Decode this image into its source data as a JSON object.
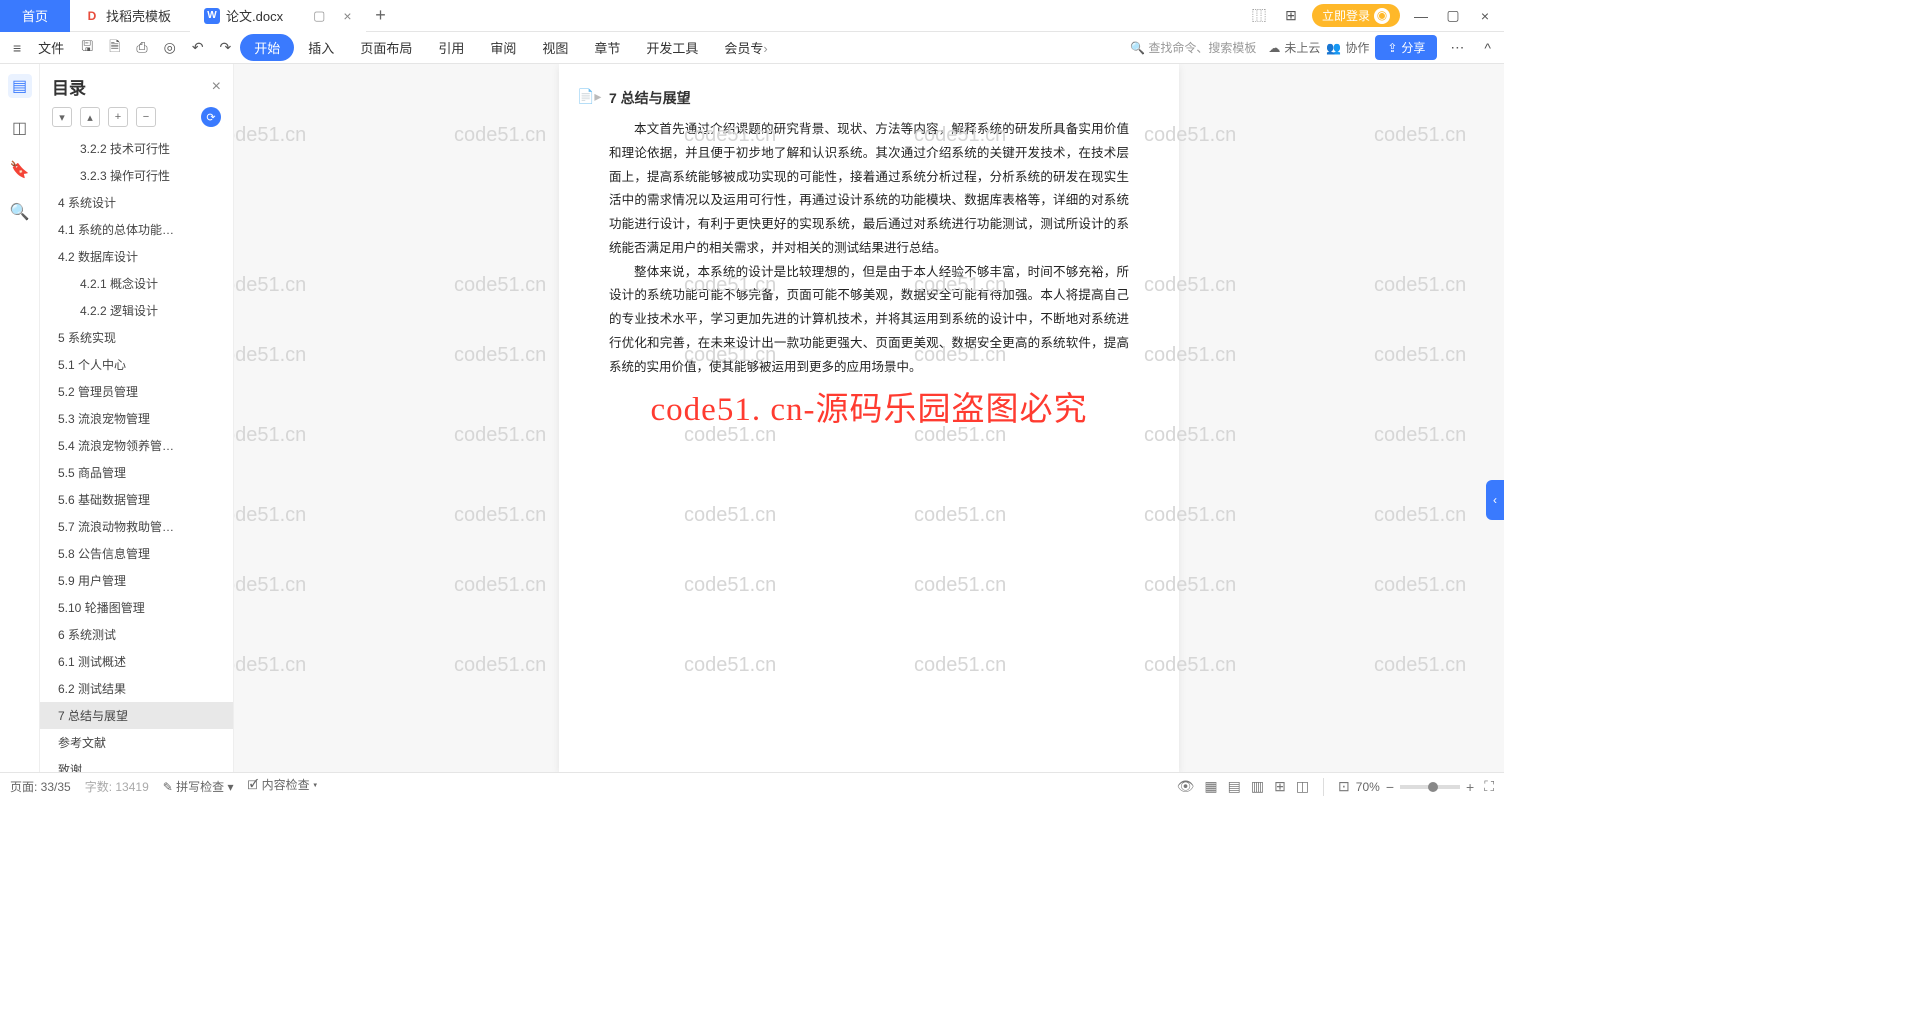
{
  "tabs": {
    "home": "首页",
    "template": "找稻壳模板",
    "doc": "论文.docx"
  },
  "titlebar": {
    "login": "立即登录"
  },
  "ribbon": {
    "file": "文件",
    "menu": [
      "开始",
      "插入",
      "页面布局",
      "引用",
      "审阅",
      "视图",
      "章节",
      "开发工具",
      "会员专"
    ],
    "search": "查找命令、搜索模板",
    "cloud": "未上云",
    "collab": "协作",
    "share": "分享"
  },
  "outline": {
    "title": "目录",
    "items": [
      {
        "label": "3.2.2 技术可行性",
        "indent": 40
      },
      {
        "label": "3.2.3 操作可行性",
        "indent": 40
      },
      {
        "label": "4 系统设计",
        "indent": 18
      },
      {
        "label": "4.1 系统的总体功能…",
        "indent": 18
      },
      {
        "label": "4.2 数据库设计",
        "indent": 18
      },
      {
        "label": "4.2.1 概念设计",
        "indent": 40
      },
      {
        "label": "4.2.2 逻辑设计",
        "indent": 40
      },
      {
        "label": "5 系统实现",
        "indent": 18
      },
      {
        "label": "5.1 个人中心",
        "indent": 18
      },
      {
        "label": "5.2 管理员管理",
        "indent": 18
      },
      {
        "label": "5.3 流浪宠物管理",
        "indent": 18
      },
      {
        "label": "5.4 流浪宠物领养管…",
        "indent": 18
      },
      {
        "label": "5.5 商品管理",
        "indent": 18
      },
      {
        "label": "5.6 基础数据管理",
        "indent": 18
      },
      {
        "label": "5.7 流浪动物救助管…",
        "indent": 18
      },
      {
        "label": "5.8 公告信息管理",
        "indent": 18
      },
      {
        "label": "5.9 用户管理",
        "indent": 18
      },
      {
        "label": "5.10 轮播图管理",
        "indent": 18
      },
      {
        "label": "6 系统测试",
        "indent": 18
      },
      {
        "label": "6.1 测试概述",
        "indent": 18
      },
      {
        "label": "6.2 测试结果",
        "indent": 18
      },
      {
        "label": "7 总结与展望",
        "indent": 18,
        "selected": true
      },
      {
        "label": "参考文献",
        "indent": 18
      },
      {
        "label": "致谢",
        "indent": 18
      }
    ]
  },
  "document": {
    "heading": "7 总结与展望",
    "p1": "本文首先通过介绍课题的研究背景、现状、方法等内容，解释系统的研发所具备实用价值和理论依据，并且便于初步地了解和认识系统。其次通过介绍系统的关键开发技术，在技术层面上，提高系统能够被成功实现的可能性，接着通过系统分析过程，分析系统的研发在现实生活中的需求情况以及运用可行性，再通过设计系统的功能模块、数据库表格等，详细的对系统功能进行设计，有利于更快更好的实现系统，最后通过对系统进行功能测试，测试所设计的系统能否满足用户的相关需求，并对相关的测试结果进行总结。",
    "p2": "整体来说，本系统的设计是比较理想的，但是由于本人经验不够丰富，时间不够充裕，所设计的系统功能可能不够完备，页面可能不够美观，数据安全可能有待加强。本人将提高自己的专业技术水平，学习更加先进的计算机技术，并将其运用到系统的设计中，不断地对系统进行优化和完善，在未来设计出一款功能更强大、页面更美观、数据安全更高的系统软件，提高系统的实用价值，使其能够被运用到更多的应用场景中。"
  },
  "watermark": "code51. cn-源码乐园盗图必究",
  "bgwm": "code51.cn",
  "status": {
    "page": "页面: 33/35",
    "words": "字数: 13419",
    "spell": "拼写检查",
    "content": "内容检查",
    "zoom": "70%"
  }
}
